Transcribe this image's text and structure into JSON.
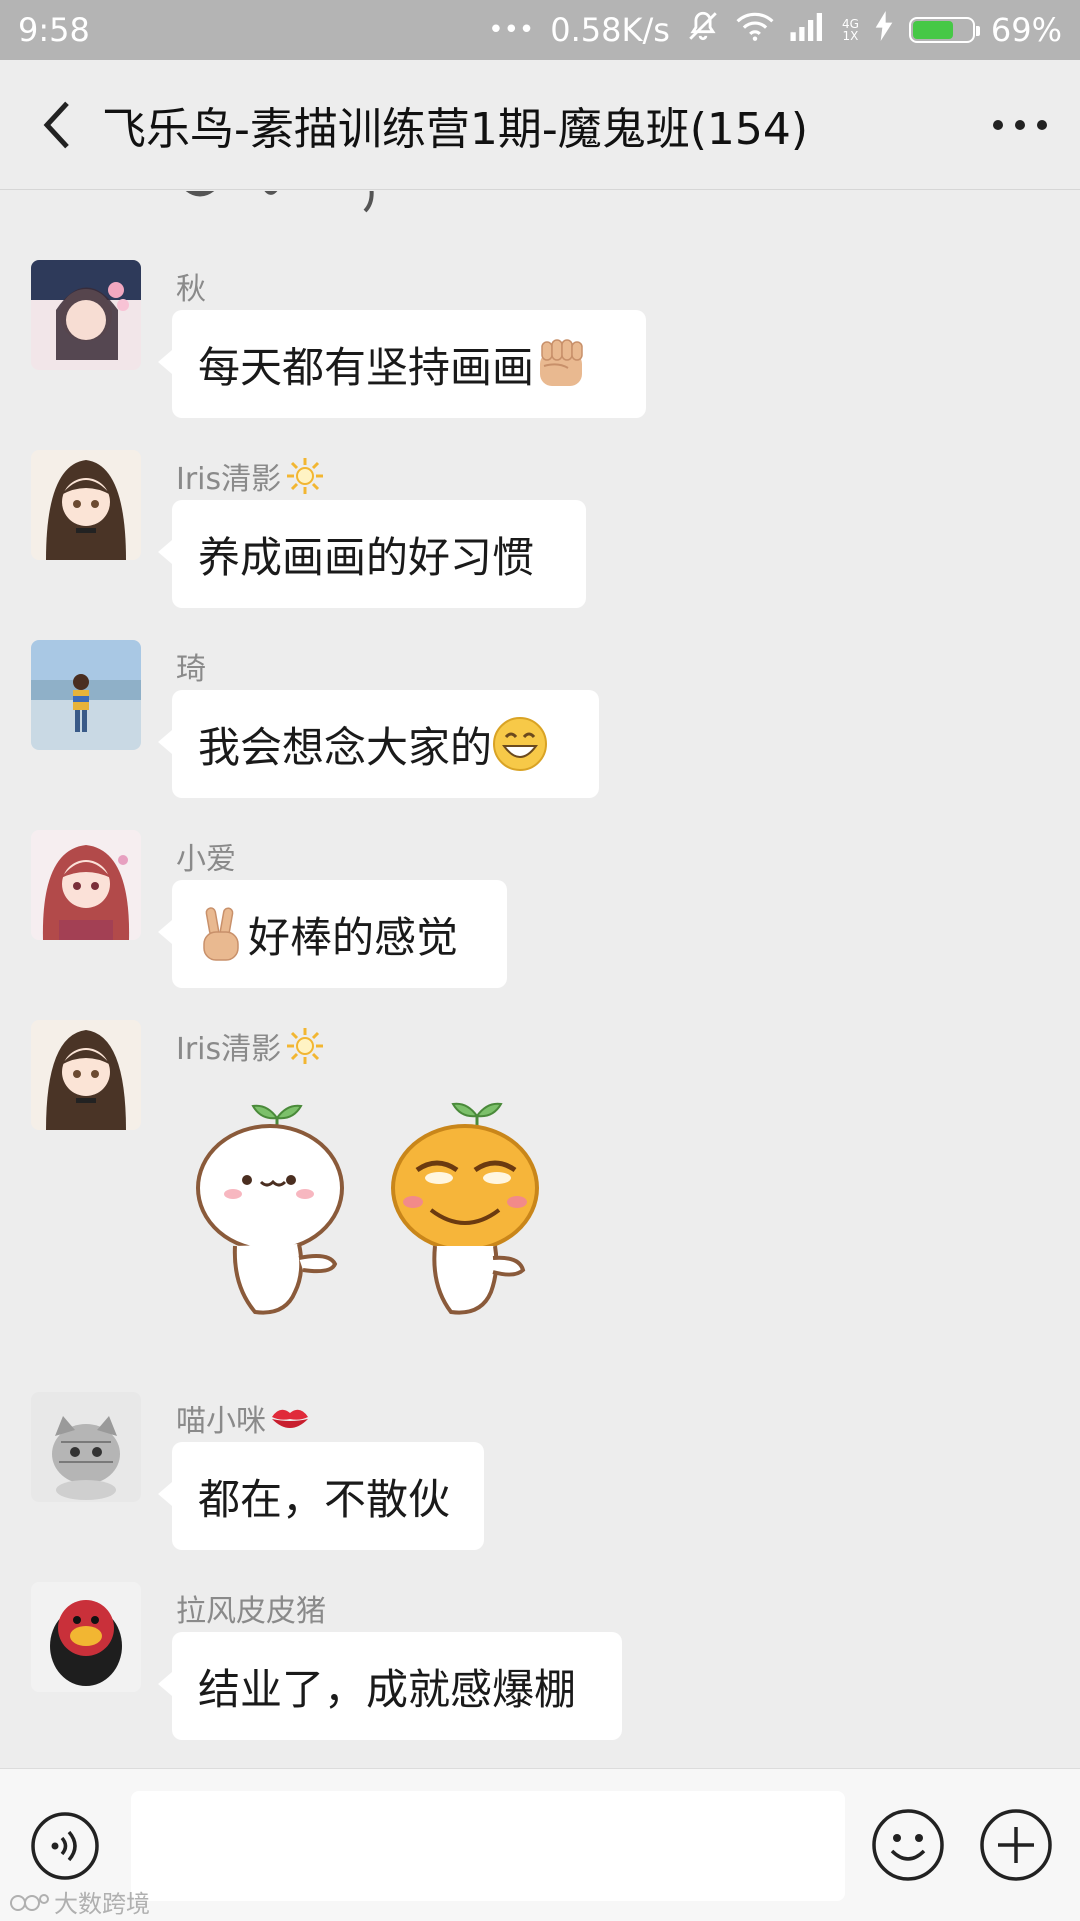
{
  "status_bar": {
    "time": "9:58",
    "dots": "•••",
    "speed": "0.58K/s",
    "network_top": "4G",
    "network_bottom": "1X",
    "battery": "69%",
    "battery_level": 0.69,
    "battery_color": "#46c846"
  },
  "header": {
    "back_icon": "chevron-left-icon",
    "title": "飞乐鸟-素描训练营1期-魔鬼班(154)",
    "more_icon": "more-horizontal-icon"
  },
  "messages": [
    {
      "name": "秋",
      "text": "每天都有坚持画画",
      "emoji_after": "fist-emoji"
    },
    {
      "name": "Iris清影",
      "name_emoji": "sun-emoji",
      "text": "养成画画的好习惯"
    },
    {
      "name": "琦",
      "text": "我会想念大家的",
      "emoji_after": "grin-emoji"
    },
    {
      "name": "小爱",
      "emoji_before": "victory-hand-emoji",
      "text": "好棒的感觉"
    },
    {
      "name": "Iris清影",
      "name_emoji": "sun-emoji",
      "sticker": "two-sprout-characters-sticker"
    },
    {
      "name": "喵小咪",
      "name_emoji": "lips-emoji",
      "text": "都在，不散伙"
    },
    {
      "name": "拉风皮皮猪",
      "text": "结业了，成就感爆棚"
    }
  ],
  "input_bar": {
    "voice_icon": "voice-icon",
    "emoji_icon": "smiley-icon",
    "plus_icon": "plus-icon",
    "input_value": ""
  },
  "watermark": "大数跨境"
}
